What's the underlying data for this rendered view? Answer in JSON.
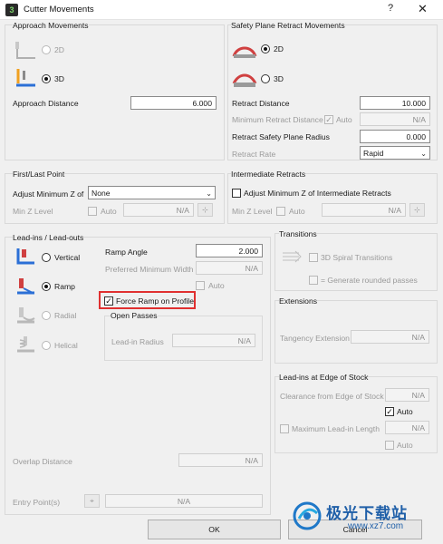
{
  "window": {
    "title": "Cutter Movements",
    "help": "?",
    "close": "✕"
  },
  "approach": {
    "title": "Approach Movements",
    "opt_2d": "2D",
    "opt_3d": "3D",
    "distance_label": "Approach Distance",
    "distance_value": "6.000"
  },
  "safety": {
    "title": "Safety Plane Retract Movements",
    "opt_2d": "2D",
    "opt_3d": "3D",
    "retract_distance_label": "Retract Distance",
    "retract_distance_value": "10.000",
    "min_retract_label": "Minimum Retract Distance",
    "min_retract_auto": "Auto",
    "min_retract_value": "N/A",
    "radius_label": "Retract Safety Plane Radius",
    "radius_value": "0.000",
    "rate_label": "Retract Rate",
    "rate_value": "Rapid"
  },
  "first_last": {
    "title": "First/Last Point",
    "adjust_label": "Adjust Minimum Z of",
    "adjust_value": "None",
    "minz_label": "Min Z Level",
    "auto": "Auto",
    "value": "N/A"
  },
  "intermediate": {
    "title": "Intermediate Retracts",
    "adjust_label": "Adjust Minimum Z of Intermediate Retracts",
    "minz_label": "Min Z Level",
    "auto": "Auto",
    "value": "N/A"
  },
  "leadins": {
    "title": "Lead-ins / Lead-outs",
    "vertical": "Vertical",
    "ramp": "Ramp",
    "radial": "Radial",
    "helical": "Helical",
    "ramp_angle_label": "Ramp Angle",
    "ramp_angle_value": "2.000",
    "pref_width_label": "Preferred Minimum Width",
    "pref_width_value": "N/A",
    "auto": "Auto",
    "force_ramp": "Force Ramp on Profile",
    "open_passes_title": "Open Passes",
    "leadin_radius_label": "Lead-in Radius",
    "leadin_radius_value": "N/A",
    "overlap_label": "Overlap Distance",
    "overlap_value": "N/A",
    "entry_label": "Entry Point(s)",
    "entry_value": "N/A"
  },
  "transitions": {
    "title": "Transitions",
    "spiral": "3D Spiral Transitions",
    "rounded": "= Generate rounded passes"
  },
  "extensions": {
    "title": "Extensions",
    "tangency_label": "Tangency Extension",
    "tangency_value": "N/A"
  },
  "edge_stock": {
    "title": "Lead-ins at Edge of Stock",
    "clearance_label": "Clearance from Edge of Stock",
    "clearance_value": "N/A",
    "auto": "Auto",
    "max_leadin_label": "Maximum Lead-in Length",
    "max_leadin_value": "N/A"
  },
  "footer": {
    "ok": "OK",
    "cancel": "Cancel"
  },
  "watermark": {
    "brand": "极光下载站",
    "url": "www.xz7.com"
  },
  "colors": {
    "highlight": "#e03030",
    "accent_orange": "#f0a020",
    "accent_blue": "#2b6fd6"
  }
}
